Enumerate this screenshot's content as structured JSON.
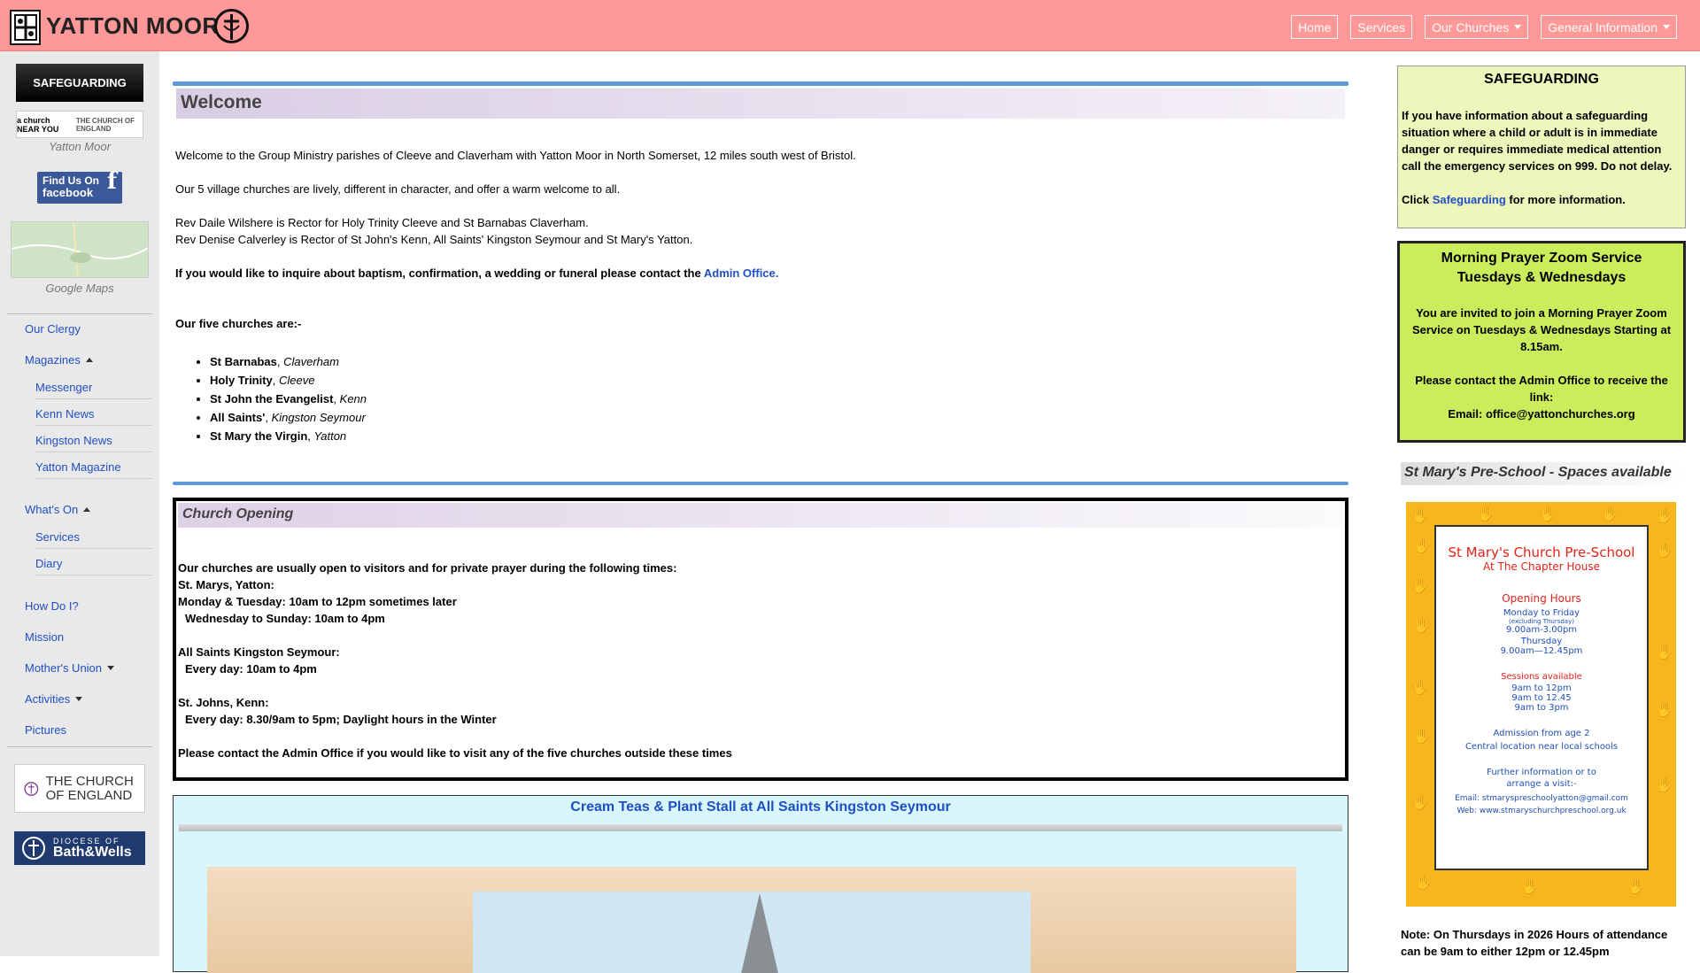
{
  "header": {
    "title": "YATTON MOOR",
    "nav": [
      {
        "label": "Home",
        "dropdown": false
      },
      {
        "label": "Services",
        "dropdown": false
      },
      {
        "label": "Our Churches",
        "dropdown": true
      },
      {
        "label": "General Information",
        "dropdown": true
      }
    ],
    "colors": {
      "bar": "#ff9999",
      "link": "#1f4fc4"
    }
  },
  "sidebar": {
    "safeguarding_label": "SAFEGUARDING",
    "acny_text": "a church NEAR YOU",
    "coe_small": "THE CHURCH OF ENGLAND",
    "acny_caption": "Yatton Moor",
    "facebook_line1": "Find Us On",
    "facebook_line2": "facebook",
    "maps_caption": "Google Maps",
    "links": {
      "clergy": "Our Clergy",
      "magazines": "Magazines",
      "messenger": "Messenger",
      "kenn_news": "Kenn News",
      "kingston_news": "Kingston News",
      "yatton_magazine": "Yatton Magazine",
      "whats_on": "What's On",
      "services": "Services",
      "diary": "Diary",
      "how_do_i": "How Do I?",
      "mission": "Mission",
      "mothers_union": "Mother's Union",
      "activities": "Activities",
      "pictures": "Pictures"
    },
    "coe_logo_text": "THE CHURCH OF ENGLAND",
    "bw_small": "DIOCESE OF",
    "bw_big": "Bath&Wells"
  },
  "main": {
    "welcome_title": "Welcome",
    "intro": "Welcome to the Group Ministry parishes of Cleeve and Claverham with Yatton Moor in North Somerset, 12 miles south west of Bristol.",
    "villages": "Our 5 village churches are lively, different in character, and offer a warm welcome to all.",
    "rector1": "Rev Daile Wilshere is Rector for Holy Trinity Cleeve and St Barnabas Claverham.",
    "rector2": "Rev Denise Calverley is Rector of St John's Kenn, All Saints' Kingston Seymour and St Mary's Yatton.",
    "inquire": "If you would like to inquire about baptism, confirmation, a wedding or funeral please contact the",
    "admin_link": "Admin Office.",
    "five_churches": "Our five churches are:-",
    "churches": [
      {
        "name": "St Barnabas",
        "place": "Claverham"
      },
      {
        "name": "Holy Trinity",
        "place": "Cleeve"
      },
      {
        "name": "St John the Evangelist",
        "place": "Kenn"
      },
      {
        "name": "All Saints'",
        "place": "Kingston Seymour"
      },
      {
        "name": "St Mary the Virgin",
        "place": "Yatton"
      }
    ],
    "opening": {
      "title": "Church Opening",
      "lines": [
        "Our churches are usually open to visitors and for private prayer during the following times:",
        "St. Marys, Yatton:",
        "Monday & Tuesday: 10am to 12pm sometimes later",
        "Wednesday to Sunday: 10am to 4pm",
        "All Saints Kingston Seymour:",
        "Every day: 10am to 4pm",
        "St. Johns, Kenn:",
        "Every day: 8.30/9am to 5pm; Daylight hours in the Winter",
        "Please contact the Admin Office if you would like to visit any of the five churches outside these times"
      ]
    },
    "teas_title": "Cream Teas & Plant Stall at All Saints Kingston Seymour"
  },
  "right": {
    "sg_title": "SAFEGUARDING",
    "sg_text": "If you have information about a safeguarding situation where a child or adult is in immediate danger or requires immediate medical attention call the emergency services on 999. Do not delay.",
    "sg_click": "Click",
    "sg_link": "Safeguarding",
    "sg_more": "for more information.",
    "mp_title1": "Morning Prayer Zoom Service",
    "mp_title2": "Tuesdays & Wednesdays",
    "mp_invite": "You are invited to join a Morning Prayer Zoom Service on Tuesdays & Wednesdays Starting at 8.15am.",
    "mp_contact": "Please contact the Admin Office to receive the link:",
    "mp_email": "Email: office@yattonchurches.org",
    "ps_heading": "St Mary's Pre-School - Spaces available",
    "poster": {
      "title": "St Mary's Church Pre-School",
      "subtitle": "At The Chapter House",
      "hours_title": "Opening Hours",
      "mf": "Monday to Friday",
      "excl": "(excluding Thursday)",
      "mf_time": "9.00am-3.00pm",
      "thu": "Thursday",
      "thu_time": "9.00am—12.45pm",
      "sessions": "Sessions available",
      "s1": "9am to 12pm",
      "s2": "9am to 12.45",
      "s3": "9am to 3pm",
      "admission": "Admission from age 2",
      "location": "Central location near local schools",
      "further1": "Further information or to",
      "further2": "arrange a visit:-",
      "email": "Email: stmaryspreschoolyatton@gmail.com",
      "web": "Web: www.stmaryschurchpreschool.org.uk"
    },
    "note": "Note: On Thursdays in 2026 Hours of attendance can be 9am to either 12pm or 12.45pm"
  }
}
